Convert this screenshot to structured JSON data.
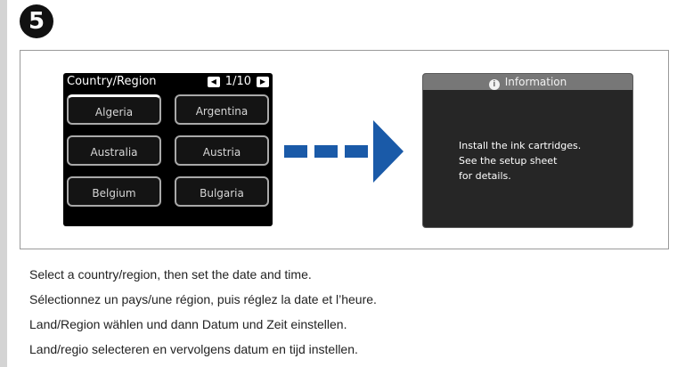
{
  "step": {
    "number": "5"
  },
  "screen1": {
    "title": "Country/Region",
    "page": "1/10",
    "prev_icon": "left-arrow-icon",
    "next_icon": "right-arrow-icon",
    "countries": [
      "Algeria",
      "Argentina",
      "Australia",
      "Austria",
      "Belgium",
      "Bulgaria"
    ],
    "selected": "Algeria"
  },
  "arrow": {
    "color": "#1a5aa8"
  },
  "screen2": {
    "title": "Information",
    "icon": "info-icon",
    "message": [
      "Install the ink cartridges.",
      "See the setup sheet",
      "for details."
    ]
  },
  "instructions": [
    "Select a country/region, then set the date and time.",
    "Sélectionnez un pays/une région, puis réglez la date et l’heure.",
    "Land/Region wählen und dann Datum und Zeit einstellen.",
    "Land/regio selecteren en vervolgens datum en tijd instellen."
  ]
}
